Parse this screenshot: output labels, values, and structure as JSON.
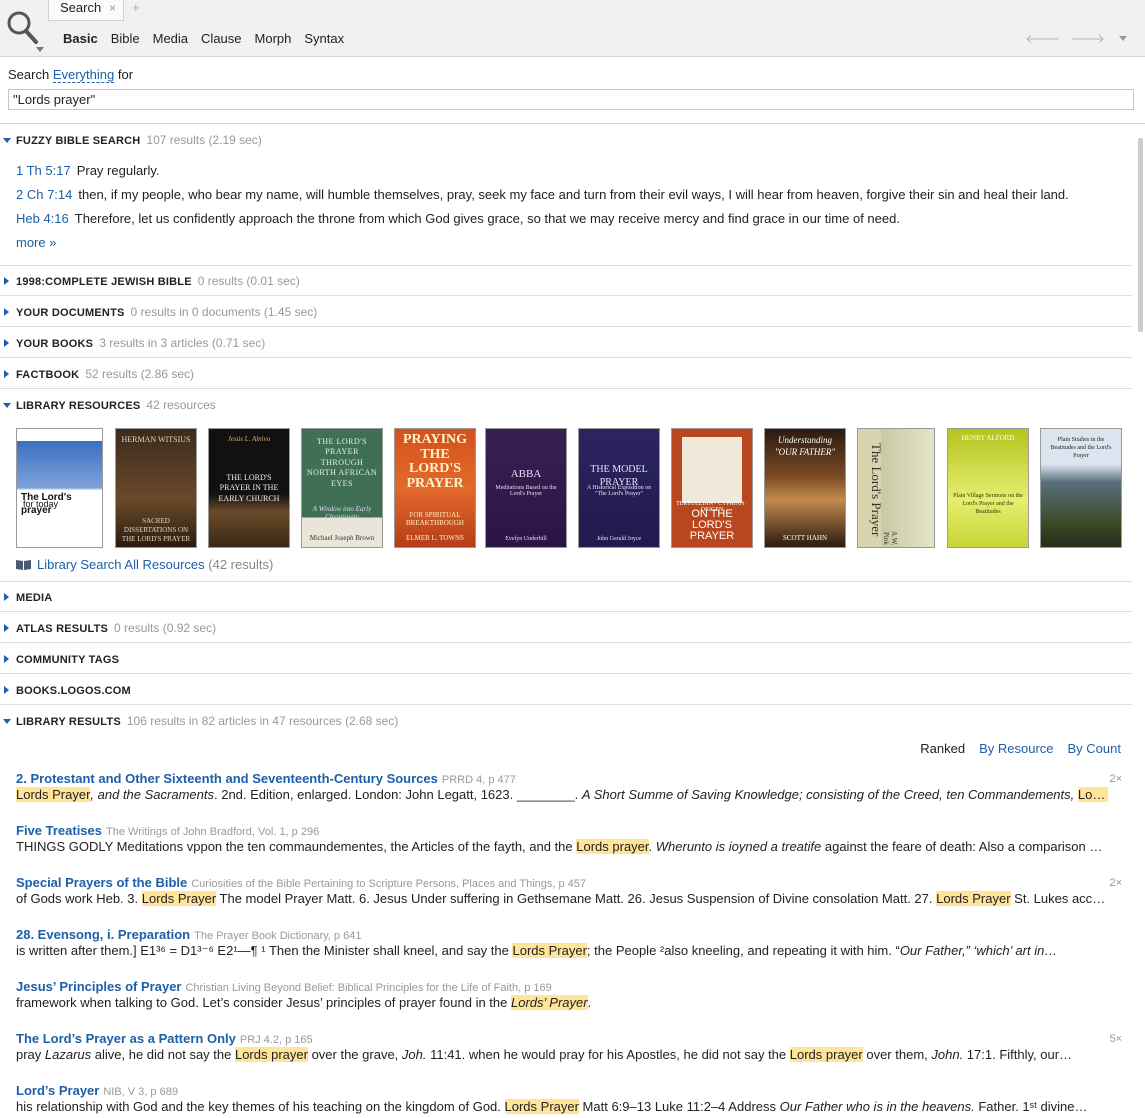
{
  "tab": {
    "label": "Search",
    "close": "×",
    "add": "+"
  },
  "subtabs": [
    "Basic",
    "Bible",
    "Media",
    "Clause",
    "Morph",
    "Syntax"
  ],
  "nav": {
    "back": "🡐",
    "forward": "🡒"
  },
  "search": {
    "prefix": "Search",
    "scope": "Everything",
    "suffix": "for",
    "query": "\"Lords prayer\""
  },
  "sections": {
    "fuzzy": {
      "title": "FUZZY BIBLE SEARCH",
      "meta": "107 results (2.19 sec)"
    },
    "cjb": {
      "title": "1998:COMPLETE JEWISH BIBLE",
      "meta": "0 results (0.01 sec)"
    },
    "docs": {
      "title": "YOUR DOCUMENTS",
      "meta": "0 results in 0 documents (1.45 sec)"
    },
    "books": {
      "title": "YOUR BOOKS",
      "meta": "3 results in 3 articles (0.71 sec)"
    },
    "factbook": {
      "title": "FACTBOOK",
      "meta": "52 results (2.86 sec)"
    },
    "library": {
      "title": "LIBRARY RESOURCES",
      "meta": "42 resources"
    },
    "media": {
      "title": "MEDIA",
      "meta": ""
    },
    "atlas": {
      "title": "ATLAS RESULTS",
      "meta": "0 results (0.92 sec)"
    },
    "tags": {
      "title": "COMMUNITY TAGS",
      "meta": ""
    },
    "logos": {
      "title": "BOOKS.LOGOS.COM",
      "meta": ""
    },
    "libresults": {
      "title": "LIBRARY RESULTS",
      "meta": "106 results in 82 articles in 47 resources (2.68 sec)"
    }
  },
  "verses": [
    {
      "ref": "1 Th 5:17",
      "text": "Pray regularly."
    },
    {
      "ref": "2 Ch 7:14",
      "text": "then, if my people, who bear my name, will humble themselves, pray, seek my face and turn from their evil ways, I will hear from heaven, forgive their sin and heal their land."
    },
    {
      "ref": "Heb 4:16",
      "text": "Therefore, let us confidently approach the throne from which God gives grace, so that we may receive mercy and find grace in our time of need."
    }
  ],
  "more": "more »",
  "covers": [
    {
      "title": "The Lord's prayer",
      "sub": "for today",
      "author": ""
    },
    {
      "title": "SACRED DISSERTATIONS ON THE LORD'S PRAYER",
      "sub": "",
      "author": "HERMAN WITSIUS"
    },
    {
      "title": "THE LORD'S PRAYER IN THE EARLY CHURCH",
      "sub": "",
      "author": "Jesús L. Alnivo"
    },
    {
      "title": "THE LORD'S PRAYER THROUGH NORTH AFRICAN EYES",
      "sub": "A Window into Early Christianity",
      "author": "Michael Joseph Brown"
    },
    {
      "title": "PRAYING THE LORD'S PRAYER",
      "sub": "FOR SPIRITUAL BREAKTHROUGH",
      "author": "ELMER L. TOWNS"
    },
    {
      "title": "ABBA",
      "sub": "Meditations Based on the Lord's Prayer",
      "author": "Evelyn Underhill"
    },
    {
      "title": "THE MODEL PRAYER",
      "sub": "A Historical Exposition on \"The Lord's Prayer\"",
      "author": "John Gerald Joyce"
    },
    {
      "title": "ON THE LORD'S PRAYER",
      "sub": "TERTULLIAN · CYPRIAN · ORIGEN",
      "author": ""
    },
    {
      "title": "Understanding \"OUR FATHER\"",
      "sub": "",
      "author": "SCOTT HAHN"
    },
    {
      "title": "The Lord's Prayer",
      "sub": "",
      "author": "A.W. Pink"
    },
    {
      "title": "Plain Village Sermons on the Lord's Prayer and the Beatitudes",
      "sub": "",
      "author": "HENRY ALFORD"
    },
    {
      "title": "Plain Studies in the Beatitudes and the Lord's Prayer",
      "sub": "",
      "author": ""
    }
  ],
  "libraryAll": {
    "label": "Library Search All Resources",
    "count": "(42 results)"
  },
  "sort": {
    "ranked": "Ranked",
    "byResource": "By Resource",
    "byCount": "By Count"
  },
  "results": [
    {
      "title": "2. Protestant and Other Sixteenth and Seventeenth-Century Sources",
      "source": "PRRD 4, p 477",
      "count": "2×",
      "parts": [
        [
          "Lords Prayer",
          "h"
        ],
        [
          ", and the Sacraments",
          ""
        ],
        [
          ". 2nd. Edition, enlarged. London: John Legatt, 1623. ________. ",
          ""
        ],
        [
          "A Short Summe of Saving Knowledge; consisting of the Creed, ten Commandements, ",
          ""
        ],
        [
          "Lords Prayer",
          "h"
        ],
        [
          ", and…",
          ""
        ]
      ]
    },
    {
      "title": "Five Treatises",
      "source": "The Writings of John Bradford, Vol. 1, p 296",
      "count": "",
      "parts": [
        [
          "THINGS GODLY Meditations vppon the ten commaundementes, the Articles of the fayth, and the ",
          ""
        ],
        [
          "Lords prayer",
          "h"
        ],
        [
          ". ",
          ""
        ],
        [
          "Wherunto is ioyned a treatife",
          ""
        ],
        [
          " against the feare of death: Also a comparison betweene the…",
          ""
        ]
      ]
    },
    {
      "title": "Special Prayers of the Bible",
      "source": "Curiosities of the Bible Pertaining to Scripture Persons, Places and Things, p 457",
      "count": "2×",
      "parts": [
        [
          "of Gods work Heb. 3. ",
          ""
        ],
        [
          "Lords Prayer",
          "h"
        ],
        [
          " The model Prayer Matt. 6. Jesus Under suffering in Gethsemane Matt. 26. Jesus Suspension of Divine consolation Matt. 27. ",
          ""
        ],
        [
          "Lords Prayer",
          "h"
        ],
        [
          " St. Lukes account Luke…",
          ""
        ]
      ]
    },
    {
      "title": "28. Evensong, i. Preparation",
      "source": "The Prayer Book Dictionary, p 641",
      "count": "",
      "parts": [
        [
          "is written after them.] E1³⁶ = D1³⁻⁶ E2¹—¶ ¹ Then the Minister shall kneel, and say the ",
          ""
        ],
        [
          "Lords Prayer",
          "h"
        ],
        [
          "; the People ²also kneeling, and repeating it with him. “",
          ""
        ],
        [
          "Our Father,” ‘which’ art in…",
          ""
        ]
      ]
    },
    {
      "title": "Jesus’ Principles of Prayer",
      "source": "Christian Living Beyond Belief: Biblical Principles for the Life of Faith, p 169",
      "count": "",
      "parts": [
        [
          "framework when talking to God. Let’s consider Jesus’ principles of prayer found in the ",
          ""
        ],
        [
          "Lords’ Prayer",
          "h"
        ],
        [
          ".",
          ""
        ]
      ]
    },
    {
      "title": "The Lord’s Prayer as a Pattern Only",
      "source": "PRJ 4.2, p 165",
      "count": "5×",
      "parts": [
        [
          "pray ",
          ""
        ],
        [
          "Lazarus",
          ""
        ],
        [
          " alive, he did not say the ",
          ""
        ],
        [
          "Lords prayer",
          "h"
        ],
        [
          " over the grave, ",
          ""
        ],
        [
          "Joh.",
          ""
        ],
        [
          " 11:41. when he would pray for his Apostles, he did not say the ",
          ""
        ],
        [
          "Lords prayer",
          "h"
        ],
        [
          " over them, ",
          ""
        ],
        [
          "John.",
          ""
        ],
        [
          " 17:1. Fifthly, our…",
          ""
        ]
      ]
    },
    {
      "title": "Lord’s Prayer",
      "source": "NIB, V 3, p 689",
      "count": "",
      "parts": [
        [
          "his relationship with God and the key themes of his teaching on the kingdom of God. ",
          ""
        ],
        [
          "Lords Prayer",
          "h"
        ],
        [
          " Matt 6:9–13 Luke 11:2–4 Address ",
          ""
        ],
        [
          "Our Father",
          ""
        ],
        [
          " who is in the heavens.",
          ""
        ],
        [
          " Father. 1ˢᵗ divine…",
          ""
        ]
      ]
    }
  ]
}
